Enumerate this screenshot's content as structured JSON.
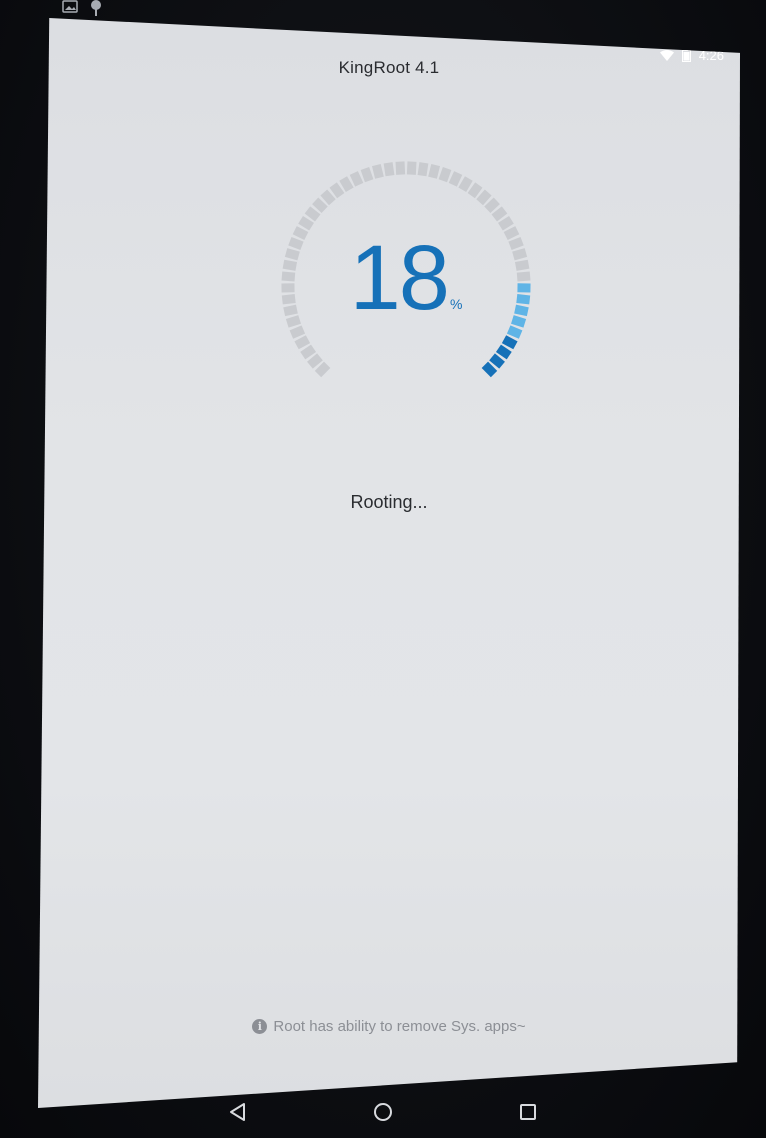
{
  "app": {
    "title": "KingRoot 4.1"
  },
  "status_bar": {
    "time": "4:26",
    "icons": [
      "wifi-icon",
      "battery-icon"
    ]
  },
  "notifications": {
    "icons": [
      "image-icon",
      "pin-icon"
    ]
  },
  "progress": {
    "value": 18,
    "value_label": "18",
    "unit": "%",
    "fraction": 0.18,
    "total_segments": 50,
    "visible_arc_degrees": 270
  },
  "status": {
    "text": "Rooting..."
  },
  "tip": {
    "icon": "info-icon",
    "text": "Root has ability to remove Sys. apps~"
  },
  "navigation": {
    "buttons": [
      "back-icon",
      "home-icon",
      "recents-icon"
    ]
  },
  "colors": {
    "accent": "#1671b8",
    "accent_light": "#5fb4e6",
    "track": "#c9cbcf",
    "screen_bg": "#e2e4e7",
    "bezel": "#0b0c10"
  }
}
